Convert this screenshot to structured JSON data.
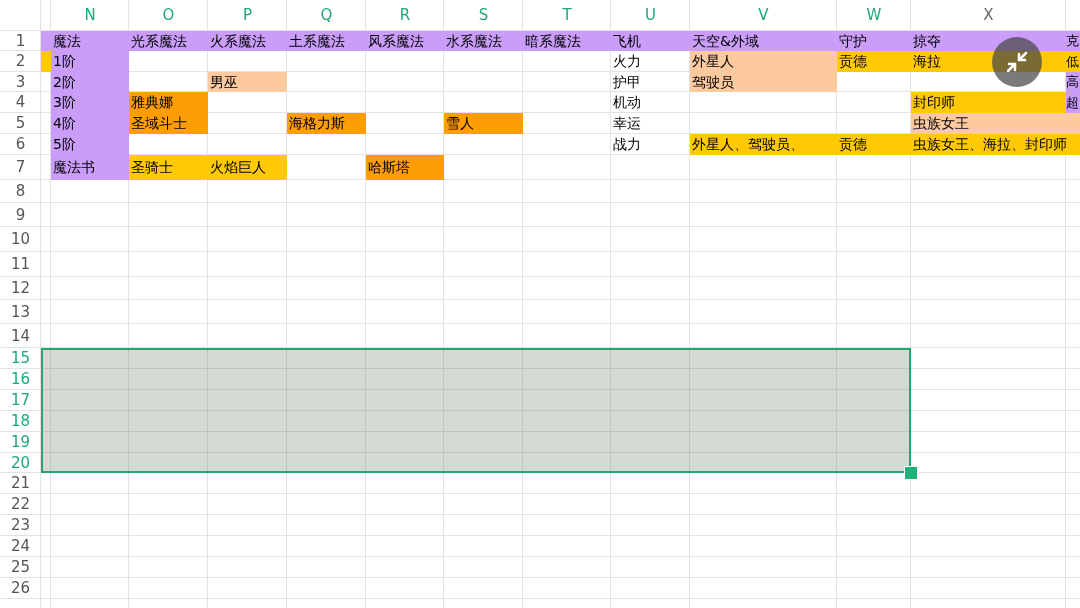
{
  "columns": [
    {
      "label": "N",
      "selected": true
    },
    {
      "label": "O",
      "selected": true
    },
    {
      "label": "P",
      "selected": true
    },
    {
      "label": "Q",
      "selected": true
    },
    {
      "label": "R",
      "selected": true
    },
    {
      "label": "S",
      "selected": true
    },
    {
      "label": "T",
      "selected": true
    },
    {
      "label": "U",
      "selected": true
    },
    {
      "label": "V",
      "selected": true
    },
    {
      "label": "W",
      "selected": true
    },
    {
      "label": "X",
      "selected": false
    }
  ],
  "rows": [
    {
      "number": "1",
      "selected": false,
      "cells": [
        {
          "color": "#c99df8"
        },
        {
          "text": "魔法",
          "color": "#c99df8"
        },
        {
          "text": "光系魔法",
          "color": "#c99df8"
        },
        {
          "text": "火系魔法",
          "color": "#c99df8"
        },
        {
          "text": "土系魔法",
          "color": "#c99df8"
        },
        {
          "text": "风系魔法",
          "color": "#c99df8"
        },
        {
          "text": "水系魔法",
          "color": "#c99df8"
        },
        {
          "text": "暗系魔法",
          "color": "#c99df8"
        },
        {
          "text": "飞机",
          "color": "#c99df8"
        },
        {
          "text": "天空&外域",
          "color": "#c99df8"
        },
        {
          "text": "守护",
          "color": "#c99df8"
        },
        {
          "text": "掠夺",
          "color": "#c99df8"
        },
        {
          "text": "克",
          "color": "#c99df8"
        }
      ]
    },
    {
      "number": "2",
      "selected": false,
      "cells": [
        {
          "color": "#ffc906"
        },
        {
          "text": "1阶",
          "color": "#c99df8"
        },
        null,
        null,
        null,
        null,
        null,
        null,
        {
          "text": "火力"
        },
        {
          "text": "外星人",
          "color": "#fdc99f"
        },
        {
          "text": "贡德",
          "color": "#ffc906"
        },
        {
          "text": "海拉",
          "color": "#ffc906"
        },
        {
          "text": "低",
          "color": "#ffc906"
        }
      ]
    },
    {
      "number": "3",
      "selected": false,
      "cells": [
        null,
        {
          "text": "2阶",
          "color": "#c99df8"
        },
        null,
        {
          "text": "男巫",
          "color": "#fdc99f"
        },
        null,
        null,
        null,
        null,
        {
          "text": "护甲"
        },
        {
          "text": "驾驶员",
          "color": "#fdc99f"
        },
        null,
        null,
        {
          "text": "高",
          "color": "#c99df8"
        }
      ]
    },
    {
      "number": "4",
      "selected": false,
      "cells": [
        null,
        {
          "text": "3阶",
          "color": "#c99df8"
        },
        {
          "text": "雅典娜",
          "color": "#ff9d05"
        },
        null,
        null,
        null,
        null,
        null,
        {
          "text": "机动"
        },
        null,
        null,
        {
          "text": "封印师",
          "color": "#ffc906"
        },
        {
          "text": "超",
          "color": "#c99df8"
        }
      ]
    },
    {
      "number": "5",
      "selected": false,
      "cells": [
        null,
        {
          "text": "4阶",
          "color": "#c99df8"
        },
        {
          "text": "圣域斗士",
          "color": "#ff9d05"
        },
        null,
        {
          "text": "海格力斯",
          "color": "#ff9d05"
        },
        null,
        {
          "text": "雪人",
          "color": "#ff9d05"
        },
        null,
        {
          "text": "幸运"
        },
        null,
        null,
        {
          "text": "虫族女王",
          "color": "#fdc99f"
        },
        null
      ]
    },
    {
      "number": "6",
      "selected": false,
      "cells": [
        null,
        {
          "text": "5阶",
          "color": "#c99df8"
        },
        null,
        null,
        null,
        null,
        null,
        null,
        {
          "text": "战力"
        },
        {
          "text": "外星人、驾驶员、",
          "color": "#ffc906"
        },
        {
          "text": "贡德",
          "color": "#ffc906"
        },
        {
          "text": "虫族女王、海拉、封印师",
          "color": "#ffc906"
        },
        null
      ]
    },
    {
      "number": "7",
      "selected": false,
      "cells": [
        null,
        {
          "text": "魔法书",
          "color": "#c99df8"
        },
        {
          "text": "圣骑士",
          "color": "#ffc906"
        },
        {
          "text": "火焰巨人",
          "color": "#ffc906"
        },
        null,
        {
          "text": "哈斯塔",
          "color": "#ff9d05"
        },
        null,
        null,
        null,
        null,
        null,
        null,
        null
      ]
    },
    {
      "number": "8",
      "selected": false
    },
    {
      "number": "9",
      "selected": false
    },
    {
      "number": "10",
      "selected": false
    },
    {
      "number": "11",
      "selected": false
    },
    {
      "number": "12",
      "selected": false
    },
    {
      "number": "13",
      "selected": false
    },
    {
      "number": "14",
      "selected": false
    },
    {
      "number": "15",
      "selected": true
    },
    {
      "number": "16",
      "selected": true
    },
    {
      "number": "17",
      "selected": true
    },
    {
      "number": "18",
      "selected": true
    },
    {
      "number": "19",
      "selected": true
    },
    {
      "number": "20",
      "selected": true
    },
    {
      "number": "21",
      "selected": false
    },
    {
      "number": "22",
      "selected": false
    },
    {
      "number": "23",
      "selected": false
    },
    {
      "number": "24",
      "selected": false
    },
    {
      "number": "25",
      "selected": false
    },
    {
      "number": "26",
      "selected": false
    }
  ]
}
